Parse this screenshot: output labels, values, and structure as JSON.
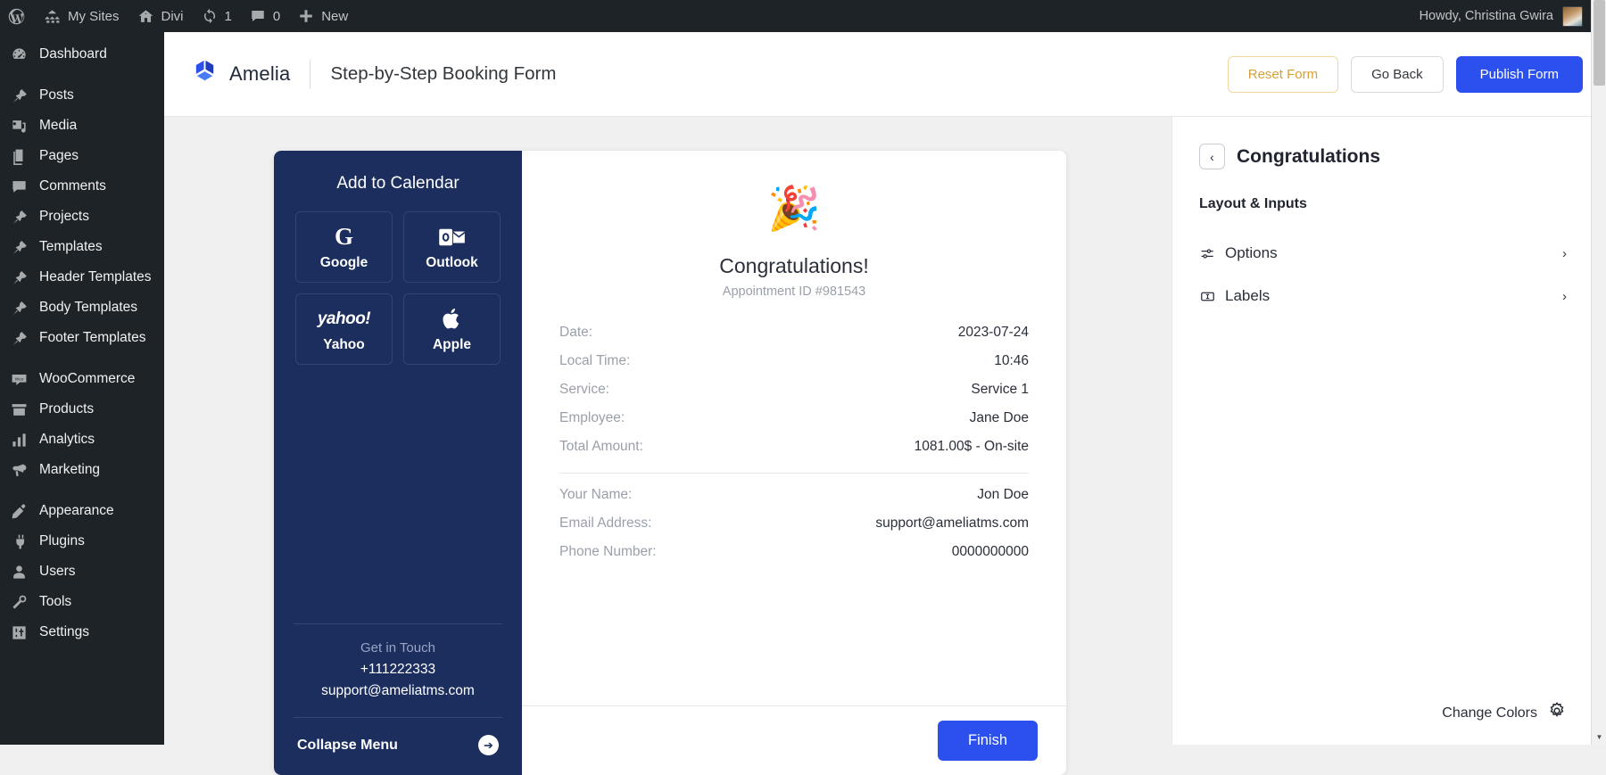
{
  "adminbar": {
    "items": [
      {
        "icon": "wordpress-icon",
        "label": ""
      },
      {
        "icon": "sites-icon",
        "label": "My Sites"
      },
      {
        "icon": "home-icon",
        "label": "Divi"
      },
      {
        "icon": "updates-icon",
        "label": "1"
      },
      {
        "icon": "comment-icon",
        "label": "0"
      },
      {
        "icon": "plus-icon",
        "label": "New"
      }
    ],
    "howdy": "Howdy, Christina Gwira"
  },
  "sidebar": {
    "items": [
      {
        "label": "Dashboard",
        "icon": "dashboard-icon",
        "gap_after": true
      },
      {
        "label": "Posts",
        "icon": "pin-icon"
      },
      {
        "label": "Media",
        "icon": "media-icon"
      },
      {
        "label": "Pages",
        "icon": "pages-icon"
      },
      {
        "label": "Comments",
        "icon": "comment-icon"
      },
      {
        "label": "Projects",
        "icon": "pin-icon"
      },
      {
        "label": "Templates",
        "icon": "pin-icon"
      },
      {
        "label": "Header Templates",
        "icon": "pin-icon"
      },
      {
        "label": "Body Templates",
        "icon": "pin-icon"
      },
      {
        "label": "Footer Templates",
        "icon": "pin-icon",
        "gap_after": true
      },
      {
        "label": "WooCommerce",
        "icon": "woo-icon"
      },
      {
        "label": "Products",
        "icon": "products-icon"
      },
      {
        "label": "Analytics",
        "icon": "analytics-icon"
      },
      {
        "label": "Marketing",
        "icon": "marketing-icon",
        "gap_after": true
      },
      {
        "label": "Appearance",
        "icon": "appearance-icon"
      },
      {
        "label": "Plugins",
        "icon": "plugins-icon"
      },
      {
        "label": "Users",
        "icon": "users-icon"
      },
      {
        "label": "Tools",
        "icon": "tools-icon"
      },
      {
        "label": "Settings",
        "icon": "settings-icon"
      }
    ]
  },
  "header": {
    "brand": "Amelia",
    "title": "Step-by-Step Booking Form",
    "reset_label": "Reset Form",
    "goback_label": "Go Back",
    "publish_label": "Publish Form",
    "accent_blue": "#2b50ed",
    "accent_gold": "#d3a13a"
  },
  "calendar": {
    "title": "Add to Calendar",
    "buttons": [
      {
        "label": "Google",
        "icon": "google-icon"
      },
      {
        "label": "Outlook",
        "icon": "outlook-icon"
      },
      {
        "label": "Yahoo",
        "icon": "yahoo-icon"
      },
      {
        "label": "Apple",
        "icon": "apple-icon"
      }
    ],
    "touch_title": "Get in Touch",
    "phone": "+111222333",
    "email": "support@ameliatms.com",
    "collapse_label": "Collapse Menu",
    "panel_color": "#1b2e5e"
  },
  "details": {
    "heading": "Congratulations!",
    "appointment_id": "Appointment ID #981543",
    "confetti": "🎉",
    "rows_top": [
      {
        "label": "Date:",
        "value": "2023-07-24"
      },
      {
        "label": "Local Time:",
        "value": "10:46"
      },
      {
        "label": "Service:",
        "value": "Service 1"
      },
      {
        "label": "Employee:",
        "value": "Jane Doe"
      },
      {
        "label": "Total Amount:",
        "value": "1081.00$ - On-site"
      }
    ],
    "rows_bottom": [
      {
        "label": "Your Name:",
        "value": "Jon Doe"
      },
      {
        "label": "Email Address:",
        "value": "support@ameliatms.com"
      },
      {
        "label": "Phone Number:",
        "value": "0000000000"
      }
    ],
    "finish_label": "Finish"
  },
  "settings": {
    "back_icon": "chevron-left-icon",
    "title": "Congratulations",
    "section": "Layout & Inputs",
    "rows": [
      {
        "label": "Options",
        "icon": "sliders-icon",
        "chevron": "›"
      },
      {
        "label": "Labels",
        "icon": "label-icon",
        "chevron": "›"
      }
    ],
    "change_colors": "Change Colors",
    "gear_icon": "gear-icon"
  }
}
